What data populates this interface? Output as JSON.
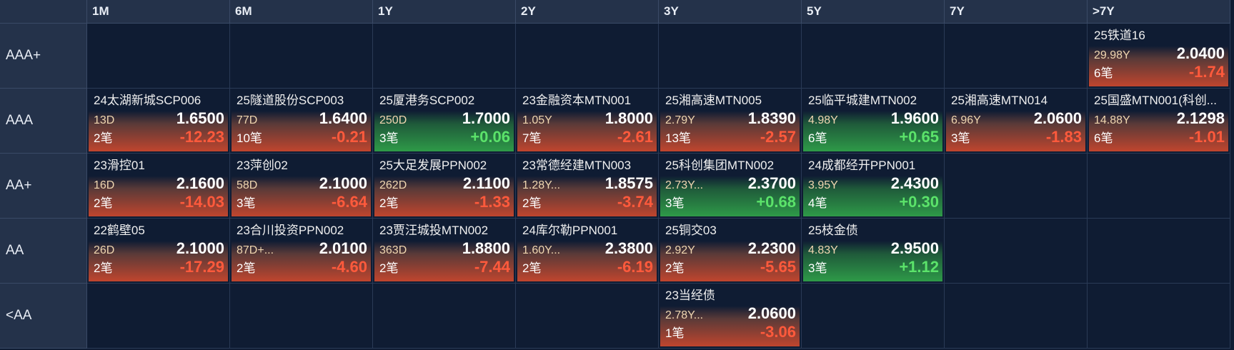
{
  "columns": [
    "1M",
    "6M",
    "1Y",
    "2Y",
    "3Y",
    "5Y",
    "7Y",
    ">7Y"
  ],
  "rows": [
    "AAA+",
    "AAA",
    "AA+",
    "AA",
    "<AA"
  ],
  "colors": {
    "up": "#5be36a",
    "down": "#ff5a3c",
    "bg": "#0f1c33",
    "header": "#24324a"
  },
  "cells": [
    [
      null,
      null,
      null,
      null,
      null,
      null,
      null,
      {
        "name": "25铁道16",
        "tenor": "29.98Y",
        "yield": "2.0400",
        "count": "6笔",
        "change": "-1.74",
        "dir": "down"
      }
    ],
    [
      {
        "name": "24太湖新城SCP006",
        "tenor": "13D",
        "yield": "1.6500",
        "count": "2笔",
        "change": "-12.23",
        "dir": "down"
      },
      {
        "name": "25隧道股份SCP003",
        "tenor": "77D",
        "yield": "1.6400",
        "count": "10笔",
        "change": "-0.21",
        "dir": "down"
      },
      {
        "name": "25厦港务SCP002",
        "tenor": "250D",
        "yield": "1.7000",
        "count": "3笔",
        "change": "+0.06",
        "dir": "up"
      },
      {
        "name": "23金融资本MTN001",
        "tenor": "1.05Y",
        "yield": "1.8000",
        "count": "7笔",
        "change": "-2.61",
        "dir": "down"
      },
      {
        "name": "25湘高速MTN005",
        "tenor": "2.79Y",
        "yield": "1.8390",
        "count": "13笔",
        "change": "-2.57",
        "dir": "down"
      },
      {
        "name": "25临平城建MTN002",
        "tenor": "4.98Y",
        "yield": "1.9600",
        "count": "6笔",
        "change": "+0.65",
        "dir": "up"
      },
      {
        "name": "25湘高速MTN014",
        "tenor": "6.96Y",
        "yield": "2.0600",
        "count": "3笔",
        "change": "-1.83",
        "dir": "down"
      },
      {
        "name": "25国盛MTN001(科创...",
        "tenor": "14.88Y",
        "yield": "2.1298",
        "count": "6笔",
        "change": "-1.01",
        "dir": "down"
      }
    ],
    [
      {
        "name": "23滑控01",
        "tenor": "16D",
        "yield": "2.1600",
        "count": "2笔",
        "change": "-14.03",
        "dir": "down"
      },
      {
        "name": "23萍创02",
        "tenor": "58D",
        "yield": "2.1000",
        "count": "3笔",
        "change": "-6.64",
        "dir": "down"
      },
      {
        "name": "25大足发展PPN002",
        "tenor": "262D",
        "yield": "2.1100",
        "count": "2笔",
        "change": "-1.33",
        "dir": "down"
      },
      {
        "name": "23常德经建MTN003",
        "tenor": "1.28Y...",
        "yield": "1.8575",
        "count": "2笔",
        "change": "-3.74",
        "dir": "down"
      },
      {
        "name": "25科创集团MTN002",
        "tenor": "2.73Y...",
        "yield": "2.3700",
        "count": "3笔",
        "change": "+0.68",
        "dir": "up"
      },
      {
        "name": "24成都经开PPN001",
        "tenor": "3.95Y",
        "yield": "2.4300",
        "count": "4笔",
        "change": "+0.30",
        "dir": "up"
      },
      null,
      null
    ],
    [
      {
        "name": "22鹤壁05",
        "tenor": "26D",
        "yield": "2.1000",
        "count": "2笔",
        "change": "-17.29",
        "dir": "down"
      },
      {
        "name": "23合川投资PPN002",
        "tenor": "87D+...",
        "yield": "2.0100",
        "count": "2笔",
        "change": "-4.60",
        "dir": "down"
      },
      {
        "name": "23贾汪城投MTN002",
        "tenor": "363D",
        "yield": "1.8800",
        "count": "2笔",
        "change": "-7.44",
        "dir": "down"
      },
      {
        "name": "24库尔勒PPN001",
        "tenor": "1.60Y...",
        "yield": "2.3800",
        "count": "2笔",
        "change": "-6.19",
        "dir": "down"
      },
      {
        "name": "25铜交03",
        "tenor": "2.92Y",
        "yield": "2.2300",
        "count": "2笔",
        "change": "-5.65",
        "dir": "down"
      },
      {
        "name": "25枝金债",
        "tenor": "4.83Y",
        "yield": "2.9500",
        "count": "3笔",
        "change": "+1.12",
        "dir": "up"
      },
      null,
      null
    ],
    [
      null,
      null,
      null,
      null,
      {
        "name": "23当经债",
        "tenor": "2.78Y...",
        "yield": "2.0600",
        "count": "1笔",
        "change": "-3.06",
        "dir": "down"
      },
      null,
      null,
      null
    ]
  ]
}
